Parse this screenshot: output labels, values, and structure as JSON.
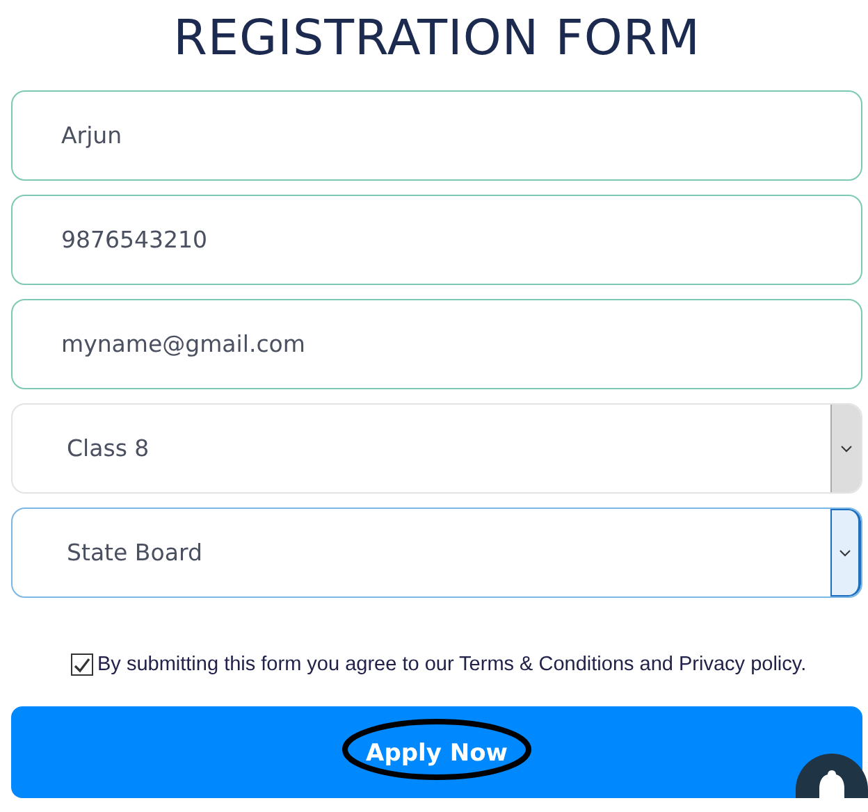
{
  "title": "REGISTRATION FORM",
  "fields": [
    {
      "kind": "input",
      "value": "Arjun",
      "focused": false
    },
    {
      "kind": "input",
      "value": "9876543210",
      "focused": false
    },
    {
      "kind": "input",
      "value": "myname@gmail.com",
      "focused": false
    },
    {
      "kind": "select",
      "value": "Class 8",
      "focused": false
    },
    {
      "kind": "select",
      "value": "State Board",
      "focused": true
    }
  ],
  "agreement": {
    "checked": true,
    "text": "By submitting this form you agree to our Terms & Conditions and Privacy policy."
  },
  "submit_button": {
    "label": "Apply Now",
    "circled": true
  }
}
